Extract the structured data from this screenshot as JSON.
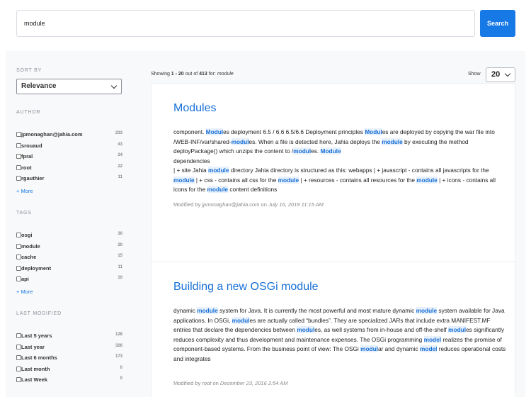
{
  "search": {
    "value": "module",
    "button_label": "Search"
  },
  "sidebar": {
    "sort_by_label": "SORT BY",
    "sort_value": "Relevance",
    "author": {
      "label": "AUTHOR",
      "items": [
        {
          "label": "jpmonaghan@jahia.com",
          "count": "233"
        },
        {
          "label": "srouaud",
          "count": "43"
        },
        {
          "label": "fpral",
          "count": "24"
        },
        {
          "label": "root",
          "count": "22"
        },
        {
          "label": "rgauthier",
          "count": "11"
        }
      ],
      "more": "+ More"
    },
    "tags": {
      "label": "TAGS",
      "items": [
        {
          "label": "osgi",
          "count": "30"
        },
        {
          "label": "module",
          "count": "20"
        },
        {
          "label": "cache",
          "count": "15"
        },
        {
          "label": "deployment",
          "count": "11"
        },
        {
          "label": "api",
          "count": "10"
        }
      ],
      "more": "+ More"
    },
    "last_modified": {
      "label": "LAST MODIFIED",
      "items": [
        {
          "label": "Last 5 years",
          "count": "128"
        },
        {
          "label": "Last year",
          "count": "326"
        },
        {
          "label": "Last 6 months",
          "count": "173"
        },
        {
          "label": "Last month",
          "count": "0"
        },
        {
          "label": "Last Week",
          "count": "0"
        }
      ]
    }
  },
  "results": {
    "showing_prefix": "Showing ",
    "range": "1 - 20",
    "out_of": " out of ",
    "total": "413",
    "for_text": " for: ",
    "query": "module",
    "show_label": "Show",
    "page_size": "20",
    "items": [
      {
        "title": "Modules",
        "body": [
          [
            "component.  ",
            ""
          ],
          [
            "Modul",
            "hl"
          ],
          [
            "es deployment 6.5 / 6.6 6.5/6.6 Deployment principles ",
            ""
          ],
          [
            "Modul",
            "hl"
          ],
          [
            "es are deployed by copying the war file into /WEB-INF/var/shared-",
            ""
          ],
          [
            "modul",
            "hl"
          ],
          [
            "es. When a file is detected here, Jahia deploys the ",
            ""
          ],
          [
            "module",
            "hl"
          ],
          [
            " by executing the method deployPackage() which unzips the content to /",
            ""
          ],
          [
            "modul",
            "hl"
          ],
          [
            "es. ",
            ""
          ],
          [
            "Module",
            "hl"
          ],
          [
            "\ndependencies\n| + site Jahia ",
            ""
          ],
          [
            "module",
            "hl"
          ],
          [
            " directory Jahia directory is structured as this:   webapps | + javascript - contains all javascripts for the ",
            ""
          ],
          [
            "module",
            "hl"
          ],
          [
            " | + css - contains all css for the ",
            ""
          ],
          [
            "module",
            "hl"
          ],
          [
            " | + resources - contains all resources for the ",
            ""
          ],
          [
            "module",
            "hl"
          ],
          [
            " | + icons - contains all icons for the ",
            ""
          ],
          [
            "module",
            "hl"
          ],
          [
            " content definitions",
            ""
          ]
        ],
        "modified_by_label": "Modified by ",
        "author": "jpmonaghan@jahia.com",
        "on_label": " on ",
        "date": "July 16, 2019 11:15 AM"
      },
      {
        "title": "Building a new OSGi module",
        "body": [
          [
            "dynamic ",
            ""
          ],
          [
            "module",
            "hl"
          ],
          [
            " system for Java. It is currently the most powerful and most mature dynamic ",
            ""
          ],
          [
            "module",
            "hl"
          ],
          [
            " system available for Java applications. In OSGi, ",
            ""
          ],
          [
            "modul",
            "hl"
          ],
          [
            "es are actually called “bundles”. They are specialized JARs that include extra MANIFEST.MF entries that declare the dependencies between ",
            ""
          ],
          [
            "modul",
            "hl"
          ],
          [
            "es, as well systems from in-house and off-the-shelf ",
            ""
          ],
          [
            "modul",
            "hl"
          ],
          [
            "es significantly reduces complexity and thus development and maintenance expenses. The OSGi programming ",
            ""
          ],
          [
            "model",
            "hl"
          ],
          [
            " realizes the promise of component-based systems. From the business point of view: The OSGi ",
            ""
          ],
          [
            "modul",
            "hl"
          ],
          [
            "ar and dynamic ",
            ""
          ],
          [
            "model",
            "hl"
          ],
          [
            " reduces operational costs and integrates",
            ""
          ]
        ],
        "modified_by_label": "Modified by ",
        "author": "root",
        "on_label": " on ",
        "date": "December 23, 2016 2:54 AM"
      }
    ]
  }
}
